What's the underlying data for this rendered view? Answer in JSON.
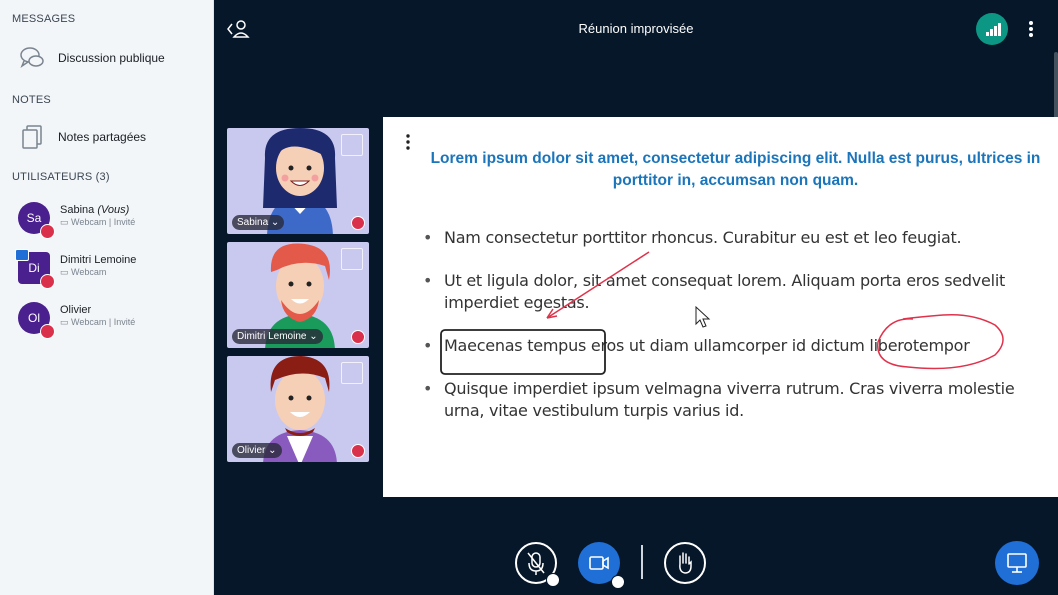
{
  "sidebar": {
    "messages_title": "MESSAGES",
    "public_chat_label": "Discussion publique",
    "notes_title": "NOTES",
    "shared_notes_label": "Notes partagées",
    "users_title": "UTILISATEURS (3)",
    "users": [
      {
        "initials": "Sa",
        "name": "Sabina",
        "you": "(Vous)",
        "sub": "Webcam | Invité"
      },
      {
        "initials": "Di",
        "name": "Dimitri Lemoine",
        "sub": "Webcam"
      },
      {
        "initials": "Ol",
        "name": "Olivier",
        "sub": "Webcam | Invité"
      }
    ]
  },
  "header": {
    "title": "Réunion improvisée"
  },
  "videos": [
    {
      "name": "Sabina"
    },
    {
      "name": "Dimitri Lemoine"
    },
    {
      "name": "Olivier"
    }
  ],
  "slide": {
    "title": "Lorem ipsum dolor sit amet, consectetur adipiscing elit. Nulla est purus, ultrices in porttitor in, accumsan non quam.",
    "bullets": [
      "Nam consectetur porttitor rhoncus. Curabitur eu est et leo feugiat.",
      "Ut et ligula dolor, sit amet consequat lorem. Aliquam porta eros sedvelit imperdiet egestas.",
      "Maecenas tempus eros ut diam ullamcorper id dictum liberotempor",
      "Quisque imperdiet ipsum velmagna viverra rutrum. Cras viverra molestie urna, vitae vestibulum turpis varius id."
    ]
  },
  "colors": {
    "accent": "#1f6fd6",
    "mute": "#d9304b",
    "teal": "#0c9784",
    "avatar": "#4a1f8e",
    "slide_title": "#1b75bb",
    "background": "#06172a"
  },
  "icons": [
    "chat-icon",
    "notes-icon",
    "user-icon",
    "signal-icon",
    "kebab-icon",
    "expand-icon",
    "mic-off-icon",
    "camera-icon",
    "hand-icon",
    "presentation-icon"
  ]
}
